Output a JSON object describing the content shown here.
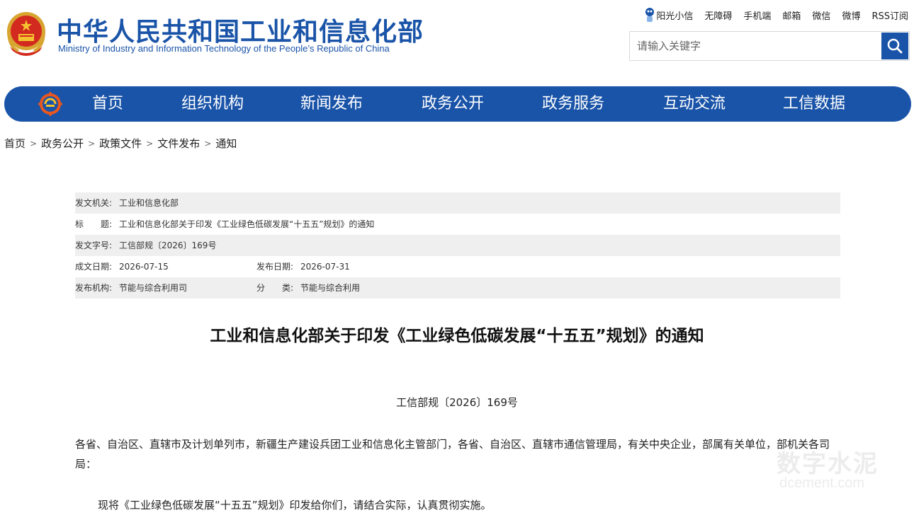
{
  "header": {
    "title_cn": "中华人民共和国工业和信息化部",
    "title_en": "Ministry of Industry and Information Technology of the People’s Republic of China",
    "top_links": [
      "阳光小信",
      "无障碍",
      "手机端",
      "邮箱",
      "微信",
      "微博",
      "RSS订阅"
    ],
    "search_placeholder": "请输入关键字",
    "brand_color": "#1a54a8"
  },
  "nav": {
    "items": [
      "首页",
      "组织机构",
      "新闻发布",
      "政务公开",
      "政务服务",
      "互动交流",
      "工信数据"
    ]
  },
  "breadcrumb": [
    "首页",
    "政务公开",
    "政策文件",
    "文件发布",
    "通知"
  ],
  "info": {
    "issuer_label": "发文机关:",
    "issuer": "工业和信息化部",
    "title_label": "标　　题:",
    "title": "工业和信息化部关于印发《工业绿色低碳发展“十五五”规划》的通知",
    "doc_no_label": "发文字号:",
    "doc_no": "工信部规〔2026〕169号",
    "created_label": "成文日期:",
    "created": "2026-07-15",
    "published_label": "发布日期:",
    "published": "2026-07-31",
    "org_label": "发布机构:",
    "org": "节能与综合利用司",
    "category_label": "分　　类:",
    "category": "节能与综合利用"
  },
  "article": {
    "title": "工业和信息化部关于印发《工业绿色低碳发展“十五五”规划》的通知",
    "doc_no": "工信部规〔2026〕169号",
    "para1": "各省、自治区、直辖市及计划单列市，新疆生产建设兵团工业和信息化主管部门，各省、自治区、直辖市通信管理局，有关中央企业，部属有关单位，部机关各司局：",
    "para2": "现将《工业绿色低碳发展“十五五”规划》印发给你们，请结合实际，认真贯彻实施。"
  },
  "watermark": {
    "text": "数字水泥",
    "url": "dcement.com"
  }
}
